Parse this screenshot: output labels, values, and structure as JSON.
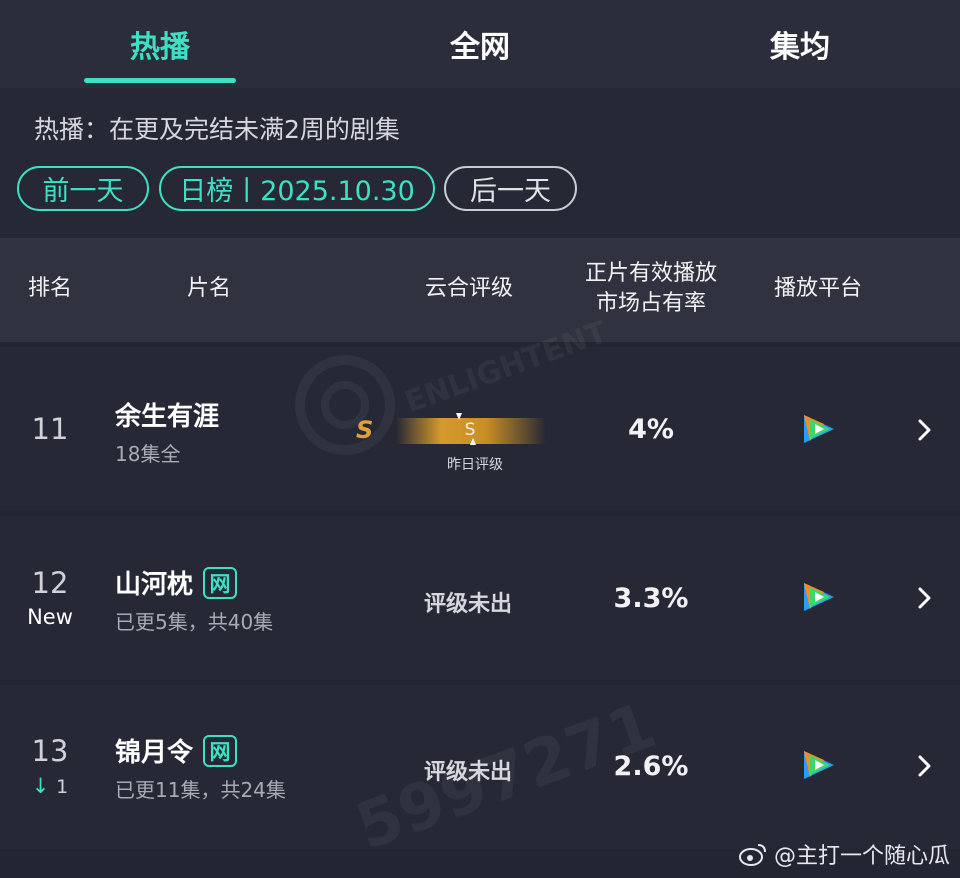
{
  "tabs": [
    {
      "label": "热播",
      "active": true
    },
    {
      "label": "全网",
      "active": false
    },
    {
      "label": "集均",
      "active": false
    }
  ],
  "description": "热播：在更及完结未满2周的剧集",
  "date_nav": {
    "prev": "前一天",
    "current": "日榜丨2025.10.30",
    "next": "后一天"
  },
  "table_header": {
    "rank": "排名",
    "title": "片名",
    "rating": "云合评级",
    "share_line1": "正片有效播放",
    "share_line2": "市场占有率",
    "platform": "播放平台"
  },
  "rows": [
    {
      "rank": "11",
      "rank_sub": "",
      "title": "余生有涯",
      "badge": "",
      "episodes": "18集全",
      "rating_letter": "S",
      "rating_bar_letter": "S",
      "rating_note": "昨日评级",
      "share": "4%",
      "platform_icon": "tencent-video-icon"
    },
    {
      "rank": "12",
      "rank_sub": "New",
      "title": "山河枕",
      "badge": "网",
      "episodes": "已更5集，共40集",
      "rating_text": "评级未出",
      "share": "3.3%",
      "platform_icon": "tencent-video-icon"
    },
    {
      "rank": "13",
      "rank_sub_arrow": "↓",
      "rank_sub": "1",
      "title": "锦月令",
      "badge": "网",
      "episodes": "已更11集，共24集",
      "rating_text": "评级未出",
      "share": "2.6%",
      "platform_icon": "tencent-video-icon"
    }
  ],
  "watermark": {
    "number": "5997271",
    "brand": "ENLIGHTENT"
  },
  "credit": "@主打一个随心瓜",
  "colors": {
    "accent": "#3ee0c4",
    "background": "#232532",
    "rating_gold": "#e0a13a"
  }
}
